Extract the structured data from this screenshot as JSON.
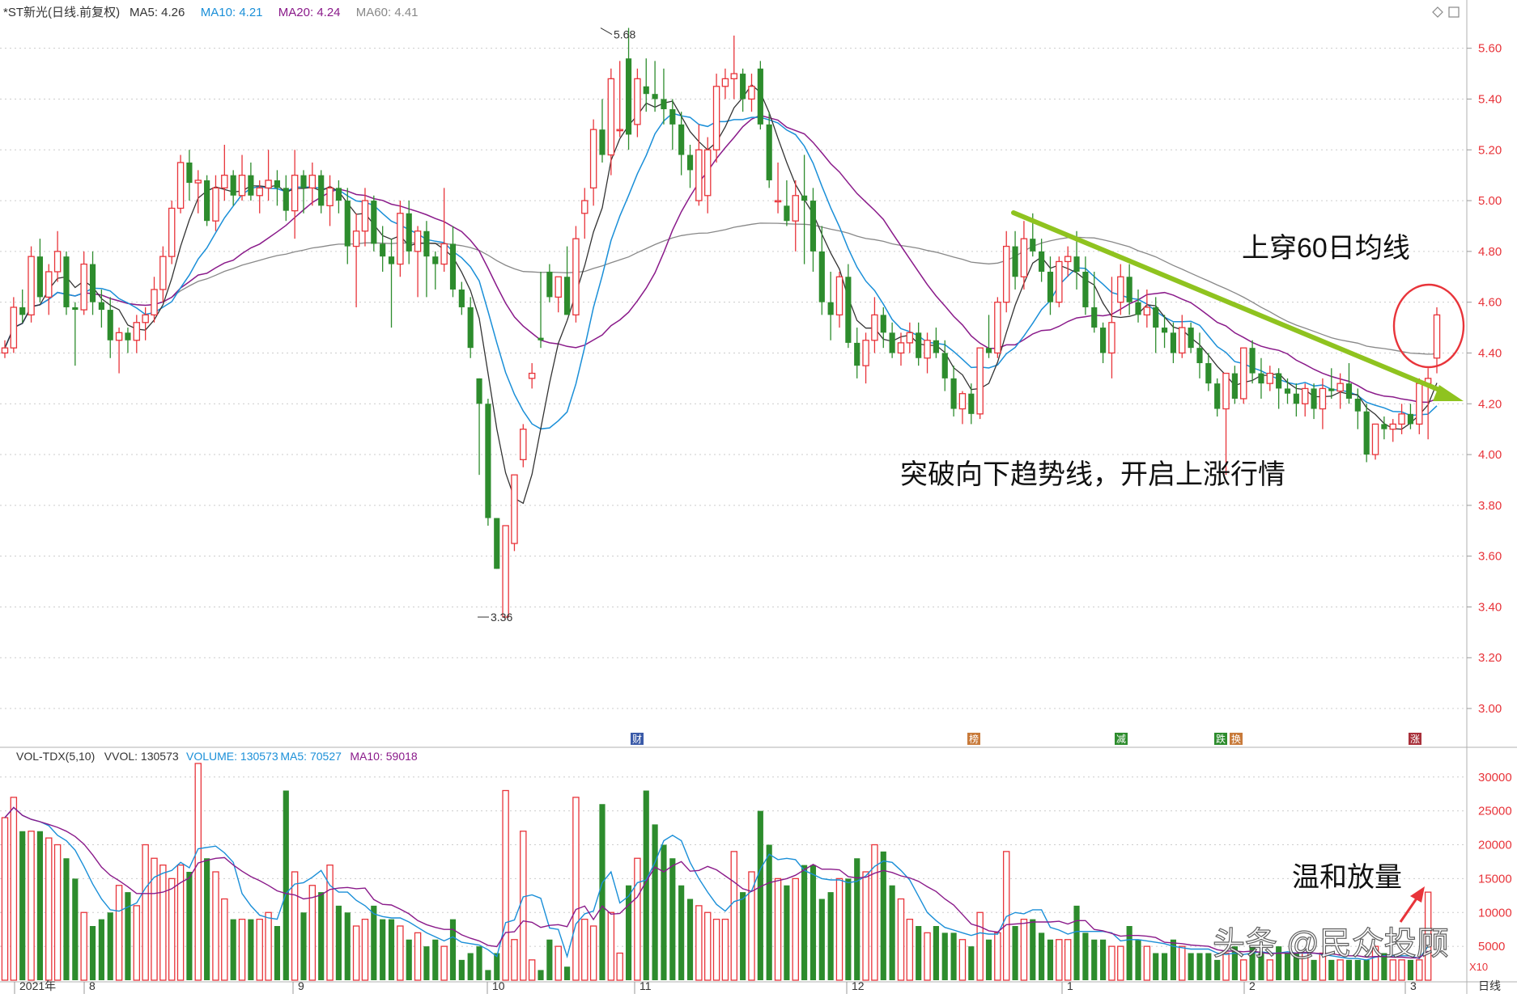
{
  "chart_data": {
    "type": "candlestick",
    "title": "*ST新光(日线.前复权)",
    "ma_legend": [
      {
        "label": "MA5: 4.26",
        "color": "#333333"
      },
      {
        "label": "MA10: 4.21",
        "color": "#1a8fd8"
      },
      {
        "label": "MA20: 4.24",
        "color": "#8a1a8a"
      },
      {
        "label": "MA60: 4.41",
        "color": "#888888"
      }
    ],
    "price_axis": {
      "ticks": [
        "5.60",
        "5.40",
        "5.20",
        "5.00",
        "4.80",
        "4.60",
        "4.40",
        "4.20",
        "4.00",
        "3.80",
        "3.60",
        "3.40",
        "3.20",
        "3.00"
      ],
      "ylim": [
        2.86,
        5.72
      ]
    },
    "volume_axis": {
      "ticks": [
        "30000",
        "25000",
        "20000",
        "15000",
        "10000",
        "5000"
      ],
      "ylim": [
        0,
        32000
      ],
      "unit": "X10"
    },
    "x_labels": [
      "2021年",
      "8",
      "9",
      "10",
      "11",
      "12",
      "1",
      "2",
      "3"
    ],
    "period_label": "日线",
    "high_label": "5.68",
    "low_label": "3.36",
    "event_markers": [
      "财",
      "榜",
      "减",
      "跌",
      "换",
      "涨"
    ],
    "volume_legend": [
      {
        "label": "VOL-TDX(5,10)",
        "color": "#333333"
      },
      {
        "label": "VVOL: 130573",
        "color": "#333333"
      },
      {
        "label": "VOLUME: 130573",
        "color": "#1a8fd8"
      },
      {
        "label": "MA5: 70527",
        "color": "#1a8fd8"
      },
      {
        "label": "MA10: 59018",
        "color": "#8a1a8a"
      }
    ],
    "annotations": [
      "上穿60日均线",
      "突破向下趋势线，开启上涨行情",
      "温和放量"
    ],
    "watermark": "头条 @民众投顾",
    "colors": {
      "up": "#e8343a",
      "down": "#2d8c2d",
      "ma5": "#333333",
      "ma10": "#1a8fd8",
      "ma20": "#8a1a8a",
      "ma60": "#888888",
      "trend": "#8fc31f"
    },
    "candles": [
      [
        4.4,
        4.45,
        4.38,
        4.42
      ],
      [
        4.42,
        4.62,
        4.4,
        4.58
      ],
      [
        4.58,
        4.65,
        4.52,
        4.55
      ],
      [
        4.55,
        4.82,
        4.52,
        4.78
      ],
      [
        4.78,
        4.85,
        4.6,
        4.62
      ],
      [
        4.62,
        4.75,
        4.55,
        4.72
      ],
      [
        4.72,
        4.88,
        4.68,
        4.8
      ],
      [
        4.78,
        4.8,
        4.55,
        4.58
      ],
      [
        4.58,
        4.6,
        4.35,
        4.57
      ],
      [
        4.57,
        4.8,
        4.55,
        4.75
      ],
      [
        4.75,
        4.8,
        4.55,
        4.6
      ],
      [
        4.6,
        4.65,
        4.5,
        4.57
      ],
      [
        4.57,
        4.62,
        4.38,
        4.45
      ],
      [
        4.45,
        4.5,
        4.32,
        4.48
      ],
      [
        4.48,
        4.5,
        4.4,
        4.45
      ],
      [
        4.45,
        4.55,
        4.4,
        4.52
      ],
      [
        4.52,
        4.58,
        4.45,
        4.55
      ],
      [
        4.55,
        4.7,
        4.52,
        4.65
      ],
      [
        4.65,
        4.82,
        4.6,
        4.78
      ],
      [
        4.78,
        5.0,
        4.75,
        4.97
      ],
      [
        4.97,
        5.18,
        4.95,
        5.15
      ],
      [
        5.15,
        5.2,
        5.0,
        5.07
      ],
      [
        5.07,
        5.12,
        4.95,
        5.08
      ],
      [
        5.08,
        5.1,
        4.9,
        4.92
      ],
      [
        4.92,
        5.1,
        4.88,
        5.05
      ],
      [
        5.05,
        5.22,
        5.0,
        5.1
      ],
      [
        5.1,
        5.12,
        4.98,
        5.02
      ],
      [
        5.02,
        5.18,
        5.0,
        5.1
      ],
      [
        5.1,
        5.15,
        5.0,
        5.02
      ],
      [
        5.02,
        5.08,
        4.95,
        5.05
      ],
      [
        5.05,
        5.2,
        5.0,
        5.08
      ],
      [
        5.08,
        5.12,
        4.98,
        5.05
      ],
      [
        5.05,
        5.1,
        4.92,
        4.96
      ],
      [
        4.96,
        5.2,
        4.85,
        5.1
      ],
      [
        5.1,
        5.12,
        4.95,
        5.05
      ],
      [
        5.05,
        5.15,
        4.98,
        5.1
      ],
      [
        5.1,
        5.12,
        4.95,
        4.98
      ],
      [
        4.98,
        5.1,
        4.9,
        5.05
      ],
      [
        5.05,
        5.08,
        4.95,
        5.0
      ],
      [
        5.0,
        5.05,
        4.75,
        4.82
      ],
      [
        4.82,
        4.95,
        4.58,
        4.88
      ],
      [
        4.88,
        5.05,
        4.82,
        5.0
      ],
      [
        5.0,
        5.02,
        4.8,
        4.83
      ],
      [
        4.83,
        4.9,
        4.72,
        4.78
      ],
      [
        4.78,
        4.85,
        4.5,
        4.75
      ],
      [
        4.75,
        5.0,
        4.7,
        4.95
      ],
      [
        4.95,
        5.0,
        4.75,
        4.8
      ],
      [
        4.8,
        4.9,
        4.62,
        4.88
      ],
      [
        4.88,
        4.92,
        4.62,
        4.78
      ],
      [
        4.78,
        4.8,
        4.65,
        4.75
      ],
      [
        4.75,
        5.05,
        4.72,
        4.83
      ],
      [
        4.83,
        4.9,
        4.62,
        4.65
      ],
      [
        4.65,
        4.68,
        4.55,
        4.58
      ],
      [
        4.58,
        4.62,
        4.38,
        4.42
      ],
      [
        4.3,
        4.3,
        3.92,
        4.2
      ],
      [
        4.2,
        4.22,
        3.72,
        3.75
      ],
      [
        3.75,
        3.75,
        3.55,
        3.55
      ],
      [
        3.36,
        3.72,
        3.36,
        3.72
      ],
      [
        3.65,
        3.92,
        3.62,
        3.92
      ],
      [
        3.98,
        4.12,
        3.95,
        4.1
      ],
      [
        4.3,
        4.36,
        4.26,
        4.32
      ],
      [
        4.46,
        4.72,
        4.42,
        4.45
      ],
      [
        4.72,
        4.75,
        4.6,
        4.62
      ],
      [
        4.62,
        4.7,
        4.56,
        4.7
      ],
      [
        4.7,
        4.82,
        4.55,
        4.55
      ],
      [
        4.55,
        4.9,
        4.52,
        4.85
      ],
      [
        4.95,
        5.05,
        4.85,
        5.0
      ],
      [
        5.05,
        5.32,
        4.98,
        5.28
      ],
      [
        5.28,
        5.4,
        5.15,
        5.18
      ],
      [
        5.18,
        5.52,
        5.1,
        5.48
      ],
      [
        5.28,
        5.55,
        5.25,
        5.28
      ],
      [
        5.56,
        5.68,
        5.2,
        5.26
      ],
      [
        5.3,
        5.52,
        5.25,
        5.48
      ],
      [
        5.45,
        5.56,
        5.35,
        5.42
      ],
      [
        5.42,
        5.55,
        5.35,
        5.4
      ],
      [
        5.4,
        5.52,
        5.3,
        5.36
      ],
      [
        5.36,
        5.4,
        5.2,
        5.3
      ],
      [
        5.3,
        5.35,
        5.1,
        5.18
      ],
      [
        5.18,
        5.22,
        5.05,
        5.12
      ],
      [
        5.0,
        5.3,
        4.98,
        5.2
      ],
      [
        5.02,
        5.25,
        4.95,
        5.2
      ],
      [
        5.2,
        5.5,
        5.15,
        5.45
      ],
      [
        5.45,
        5.52,
        5.4,
        5.48
      ],
      [
        5.48,
        5.65,
        5.4,
        5.5
      ],
      [
        5.5,
        5.52,
        5.35,
        5.4
      ],
      [
        5.4,
        5.5,
        5.35,
        5.45
      ],
      [
        5.52,
        5.55,
        5.28,
        5.3
      ],
      [
        5.3,
        5.35,
        5.05,
        5.08
      ],
      [
        5.0,
        5.15,
        4.95,
        5.0
      ],
      [
        4.98,
        5.08,
        4.9,
        4.92
      ],
      [
        4.92,
        5.08,
        4.8,
        5.02
      ],
      [
        5.02,
        5.18,
        4.75,
        5.0
      ],
      [
        5.0,
        5.05,
        4.72,
        4.8
      ],
      [
        4.8,
        4.9,
        4.55,
        4.6
      ],
      [
        4.6,
        4.72,
        4.45,
        4.55
      ],
      [
        4.55,
        4.72,
        4.5,
        4.7
      ],
      [
        4.7,
        4.75,
        4.42,
        4.44
      ],
      [
        4.44,
        4.5,
        4.3,
        4.35
      ],
      [
        4.35,
        4.48,
        4.28,
        4.45
      ],
      [
        4.45,
        4.62,
        4.4,
        4.55
      ],
      [
        4.55,
        4.58,
        4.42,
        4.48
      ],
      [
        4.48,
        4.52,
        4.38,
        4.4
      ],
      [
        4.4,
        4.48,
        4.35,
        4.44
      ],
      [
        4.44,
        4.52,
        4.4,
        4.48
      ],
      [
        4.48,
        4.52,
        4.35,
        4.38
      ],
      [
        4.38,
        4.48,
        4.32,
        4.45
      ],
      [
        4.45,
        4.5,
        4.38,
        4.4
      ],
      [
        4.4,
        4.45,
        4.25,
        4.3
      ],
      [
        4.3,
        4.35,
        4.15,
        4.18
      ],
      [
        4.18,
        4.25,
        4.12,
        4.24
      ],
      [
        4.24,
        4.28,
        4.12,
        4.16
      ],
      [
        4.16,
        4.42,
        4.14,
        4.42
      ],
      [
        4.42,
        4.55,
        4.38,
        4.4
      ],
      [
        4.4,
        4.62,
        4.38,
        4.6
      ],
      [
        4.6,
        4.88,
        4.56,
        4.82
      ],
      [
        4.82,
        4.88,
        4.65,
        4.7
      ],
      [
        4.7,
        4.92,
        4.65,
        4.85
      ],
      [
        4.85,
        4.95,
        4.78,
        4.8
      ],
      [
        4.8,
        4.85,
        4.68,
        4.72
      ],
      [
        4.72,
        4.78,
        4.55,
        4.6
      ],
      [
        4.6,
        4.78,
        4.58,
        4.76
      ],
      [
        4.76,
        4.82,
        4.7,
        4.78
      ],
      [
        4.78,
        4.88,
        4.65,
        4.72
      ],
      [
        4.72,
        4.78,
        4.55,
        4.58
      ],
      [
        4.58,
        4.72,
        4.48,
        4.5
      ],
      [
        4.5,
        4.52,
        4.36,
        4.4
      ],
      [
        4.4,
        4.7,
        4.3,
        4.52
      ],
      [
        4.6,
        4.75,
        4.55,
        4.7
      ],
      [
        4.7,
        4.75,
        4.55,
        4.6
      ],
      [
        4.6,
        4.65,
        4.52,
        4.55
      ],
      [
        4.55,
        4.65,
        4.5,
        4.58
      ],
      [
        4.58,
        4.62,
        4.4,
        4.5
      ],
      [
        4.5,
        4.55,
        4.42,
        4.48
      ],
      [
        4.48,
        4.52,
        4.36,
        4.4
      ],
      [
        4.4,
        4.55,
        4.38,
        4.5
      ],
      [
        4.5,
        4.52,
        4.4,
        4.42
      ],
      [
        4.42,
        4.48,
        4.3,
        4.36
      ],
      [
        4.36,
        4.4,
        4.25,
        4.28
      ],
      [
        4.28,
        4.3,
        4.15,
        4.18
      ],
      [
        4.18,
        4.32,
        3.92,
        4.32
      ],
      [
        4.32,
        4.35,
        4.2,
        4.22
      ],
      [
        4.22,
        4.42,
        4.2,
        4.42
      ],
      [
        4.42,
        4.45,
        4.28,
        4.32
      ],
      [
        4.32,
        4.38,
        4.22,
        4.28
      ],
      [
        4.28,
        4.35,
        4.25,
        4.32
      ],
      [
        4.32,
        4.34,
        4.18,
        4.26
      ],
      [
        4.26,
        4.3,
        4.2,
        4.24
      ],
      [
        4.24,
        4.28,
        4.15,
        4.2
      ],
      [
        4.2,
        4.28,
        4.15,
        4.26
      ],
      [
        4.26,
        4.28,
        4.14,
        4.18
      ],
      [
        4.18,
        4.3,
        4.1,
        4.26
      ],
      [
        4.26,
        4.34,
        4.22,
        4.25
      ],
      [
        4.25,
        4.32,
        4.18,
        4.28
      ],
      [
        4.28,
        4.36,
        4.2,
        4.22
      ],
      [
        4.22,
        4.26,
        4.1,
        4.17
      ],
      [
        4.17,
        4.2,
        3.97,
        4.0
      ],
      [
        4.0,
        4.12,
        3.98,
        4.12
      ],
      [
        4.12,
        4.15,
        4.06,
        4.1
      ],
      [
        4.1,
        4.14,
        4.05,
        4.12
      ],
      [
        4.12,
        4.2,
        4.08,
        4.16
      ],
      [
        4.16,
        4.2,
        4.1,
        4.12
      ],
      [
        4.12,
        4.3,
        4.08,
        4.28
      ],
      [
        4.28,
        4.34,
        4.06,
        4.3
      ],
      [
        4.38,
        4.58,
        4.32,
        4.55
      ]
    ],
    "volumes": [
      24,
      27,
      22,
      22,
      22,
      21,
      20,
      18,
      15,
      10,
      8,
      9,
      10,
      14,
      13,
      11,
      20,
      18,
      17,
      15,
      17,
      16,
      32,
      18,
      16,
      12,
      9,
      9,
      9,
      9,
      10,
      8,
      28,
      16,
      10,
      14,
      13,
      17,
      11,
      10,
      8,
      9,
      11,
      9,
      9,
      8,
      6,
      7,
      5,
      6,
      5,
      9,
      3,
      4,
      5,
      1.5,
      4,
      28,
      6,
      22,
      3,
      1.5,
      6,
      5,
      2,
      27,
      9,
      8,
      26,
      10,
      4,
      14,
      18,
      28,
      23,
      20,
      18,
      14,
      12,
      11,
      10,
      9,
      9,
      19,
      13,
      16,
      25,
      20,
      15,
      14,
      15,
      17,
      17,
      12,
      13,
      15,
      15,
      18,
      16,
      20,
      19,
      14,
      12,
      9,
      8,
      7,
      8,
      7,
      7,
      6,
      5,
      10,
      6,
      7,
      19,
      8,
      9,
      9,
      7,
      6,
      6,
      6,
      11,
      7,
      6,
      6,
      5,
      5,
      8,
      6,
      5,
      4,
      4,
      6,
      5,
      4,
      4,
      4,
      3,
      4,
      5,
      3,
      5,
      4,
      3,
      5,
      4,
      4,
      4,
      3,
      4,
      3,
      3,
      3,
      3,
      3,
      5,
      4,
      3,
      3,
      3,
      3,
      13
    ]
  }
}
